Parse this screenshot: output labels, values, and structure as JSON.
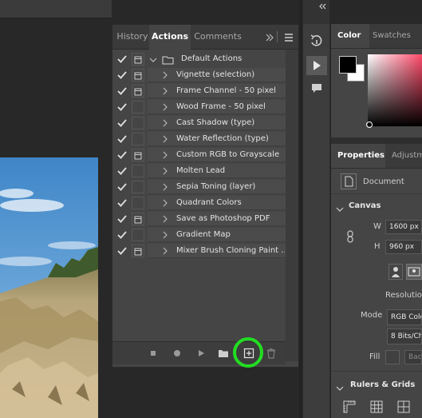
{
  "actions_panel": {
    "tabs": [
      {
        "label": "History"
      },
      {
        "label": "Actions"
      },
      {
        "label": "Comments"
      }
    ],
    "set_name": "Default Actions",
    "items": [
      {
        "label": "Vignette (selection)",
        "checked": true,
        "dialog": true
      },
      {
        "label": "Frame Channel - 50 pixel",
        "checked": true,
        "dialog": true
      },
      {
        "label": "Wood Frame - 50 pixel",
        "checked": true,
        "dialog": false
      },
      {
        "label": "Cast Shadow (type)",
        "checked": true,
        "dialog": false
      },
      {
        "label": "Water Reflection (type)",
        "checked": true,
        "dialog": false
      },
      {
        "label": "Custom RGB to Grayscale",
        "checked": true,
        "dialog": true
      },
      {
        "label": "Molten Lead",
        "checked": true,
        "dialog": false
      },
      {
        "label": "Sepia Toning (layer)",
        "checked": true,
        "dialog": false
      },
      {
        "label": "Quadrant Colors",
        "checked": true,
        "dialog": false
      },
      {
        "label": "Save as Photoshop PDF",
        "checked": true,
        "dialog": true
      },
      {
        "label": "Gradient Map",
        "checked": true,
        "dialog": false
      },
      {
        "label": "Mixer Brush Cloning Paint ...",
        "checked": true,
        "dialog": true
      }
    ],
    "footer_icons": [
      "stop-icon",
      "record-icon",
      "play-icon",
      "folder-icon",
      "new-action-icon",
      "trash-icon"
    ]
  },
  "tool_strip": {
    "icons": [
      "collapse-icon",
      "history-brush-icon",
      "play-icon",
      "comment-icon"
    ]
  },
  "color_panel": {
    "tabs": [
      {
        "label": "Color"
      },
      {
        "label": "Swatches"
      }
    ],
    "foreground": "#000000",
    "background": "#ffffff"
  },
  "properties_panel": {
    "tabs": [
      {
        "label": "Properties"
      },
      {
        "label": "Adjustm"
      }
    ],
    "type_label": "Document",
    "canvas_section": "Canvas",
    "width_label": "W",
    "width_value": "1600 px",
    "height_label": "H",
    "height_value": "960 px",
    "resolution_label": "Resolution",
    "mode_label": "Mode",
    "mode_value": "RGB Colo",
    "bits_value": "8 Bits/Ch",
    "fill_label": "Fill",
    "fill_value": "Bac",
    "rulers_section": "Rulers & Grids"
  },
  "colors": {
    "accent_highlight": "#22dd22",
    "panel_bg": "#454545"
  }
}
